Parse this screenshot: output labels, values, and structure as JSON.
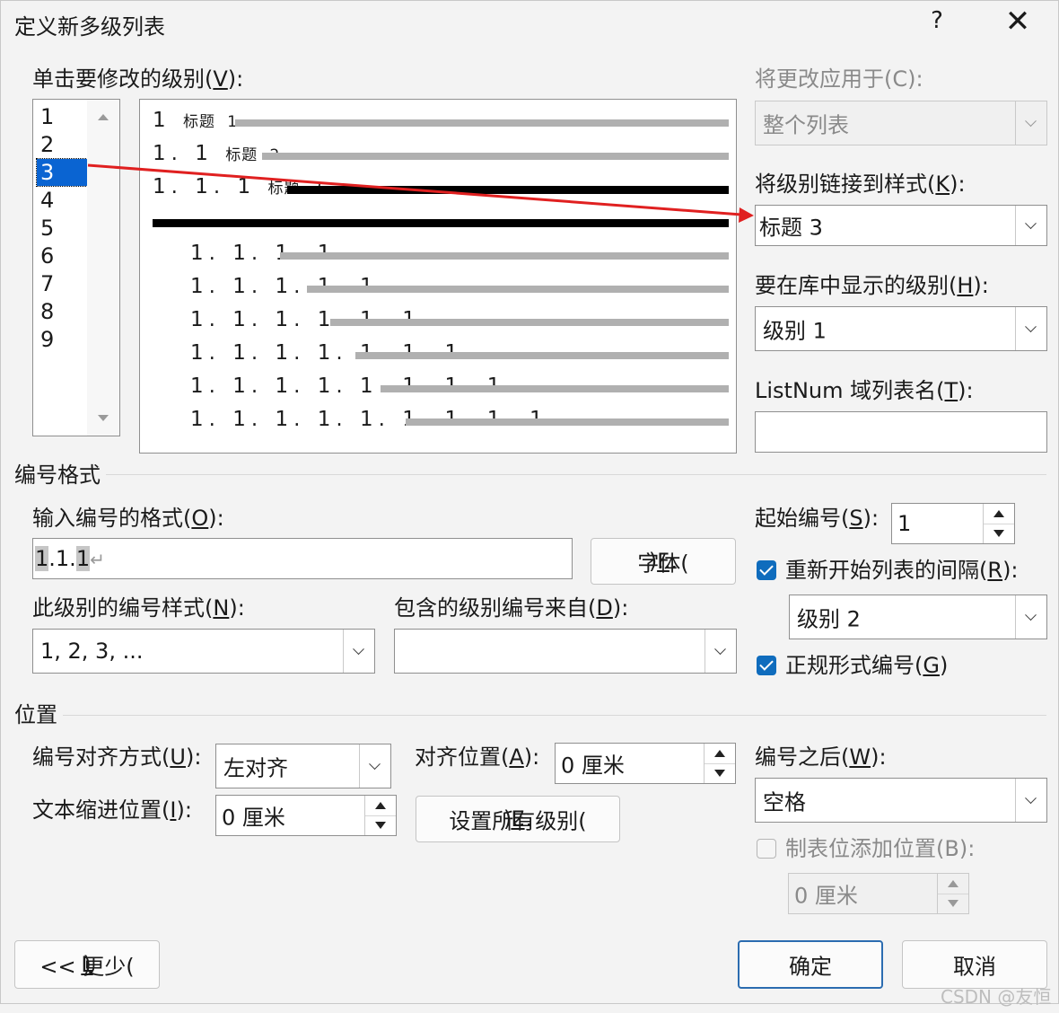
{
  "window": {
    "title": "定义新多级列表",
    "help": "?",
    "close": "✕"
  },
  "level_section": {
    "label_prefix": "单击要修改的级别(",
    "label_key": "V",
    "label_suffix": "):",
    "levels": [
      "1",
      "2",
      "3",
      "4",
      "5",
      "6",
      "7",
      "8",
      "9"
    ],
    "selected_level": "3"
  },
  "preview": {
    "rows": [
      {
        "num": "1",
        "heading": "标题",
        "heading_num": "1"
      },
      {
        "num": "1. 1",
        "heading": "标题",
        "heading_num": "2"
      },
      {
        "num": "1. 1. 1",
        "heading": "标题",
        "heading_num": "3"
      },
      {
        "num": "1. 1. 1. 1"
      },
      {
        "num": "1. 1. 1. 1. 1"
      },
      {
        "num": "1. 1. 1. 1. 1. 1"
      },
      {
        "num": "1. 1. 1. 1. 1. 1. 1"
      },
      {
        "num": "1. 1. 1. 1. 1. 1. 1. 1"
      },
      {
        "num": "1. 1. 1. 1. 1. 1. 1. 1. 1"
      }
    ]
  },
  "right_panel": {
    "apply_to_label": "将更改应用于(C):",
    "apply_to_value": "整个列表",
    "link_style_prefix": "将级别链接到样式(",
    "link_style_key": "K",
    "link_style_suffix": "):",
    "link_style_value": "标题 3",
    "gallery_level_prefix": "要在库中显示的级别(",
    "gallery_level_key": "H",
    "gallery_level_suffix": "):",
    "gallery_level_value": "级别 1",
    "listnum_prefix": "ListNum 域列表名(",
    "listnum_key": "T",
    "listnum_suffix": "):",
    "listnum_value": ""
  },
  "number_format": {
    "section_title": "编号格式",
    "format_label_prefix": "输入编号的格式(",
    "format_label_key": "O",
    "format_label_suffix": "):",
    "format_part1": "1",
    "format_mid": ".1.",
    "format_part2": "1",
    "format_mark": "↵",
    "font_button_prefix": "字体(",
    "font_button_key": "F",
    "font_button_suffix": ")...",
    "style_label_prefix": "此级别的编号样式(",
    "style_label_key": "N",
    "style_label_suffix": "):",
    "style_value": "1, 2, 3, ...",
    "include_label_prefix": "包含的级别编号来自(",
    "include_label_key": "D",
    "include_label_suffix": "):",
    "include_value": "",
    "start_label_prefix": "起始编号(",
    "start_label_key": "S",
    "start_label_suffix": "):",
    "start_value": "1",
    "restart_label_prefix": "重新开始列表的间隔(",
    "restart_label_key": "R",
    "restart_label_suffix": "):",
    "restart_checked": true,
    "restart_value": "级别 2",
    "legal_label_prefix": "正规形式编号(",
    "legal_label_key": "G",
    "legal_label_suffix": ")",
    "legal_checked": true
  },
  "position": {
    "section_title": "位置",
    "align_label_prefix": "编号对齐方式(",
    "align_label_key": "U",
    "align_label_suffix": "):",
    "align_value": "左对齐",
    "align_at_prefix": "对齐位置(",
    "align_at_key": "A",
    "align_at_suffix": "):",
    "align_at_value": "0 厘米",
    "indent_prefix": "文本缩进位置(",
    "indent_key": "I",
    "indent_suffix": "):",
    "indent_value": "0 厘米",
    "set_all_prefix": "设置所有级别(",
    "set_all_key": "E",
    "set_all_suffix": ")...",
    "follow_prefix": "编号之后(",
    "follow_key": "W",
    "follow_suffix": "):",
    "follow_value": "空格",
    "tab_stop_label": "制表位添加位置(B):",
    "tab_stop_checked": false,
    "tab_stop_value": "0 厘米"
  },
  "footer": {
    "less_prefix": "<< 更少(",
    "less_key": "L",
    "less_suffix": ")",
    "ok": "确定",
    "cancel": "取消"
  },
  "watermark": "CSDN @友恒",
  "colors": {
    "accent": "#0f6cbd",
    "selection": "#0a64d2",
    "annotation_arrow": "#e02020"
  }
}
